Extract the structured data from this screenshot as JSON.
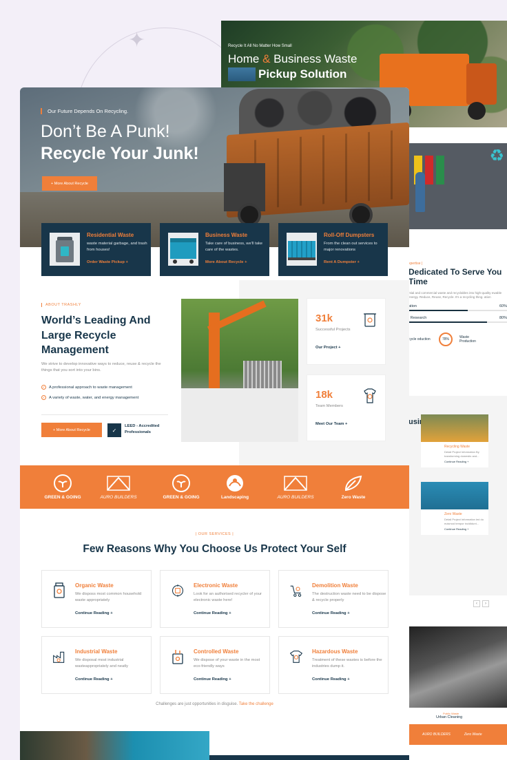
{
  "back_page": {
    "hero_small": "Recycle It All No Matter How Small",
    "hero_title_a": "Home",
    "hero_title_amp": "&",
    "hero_title_b": "Business Waste",
    "hero_title_2": "Pickup Solution",
    "expertise_tag": "xpertise |",
    "expertise_title": "Dedicated To Serve You Time",
    "expertise_text": "ntial and commercial waste and recyclables into high-quality ewable energy. Reduce, Reuse, Recycle. It's a recycling thing. ation",
    "bars": [
      {
        "label": "ation",
        "value": "60%",
        "fill": 0.6
      },
      {
        "label": "l Research",
        "value": "80%",
        "fill": 0.8
      }
    ],
    "circles": [
      {
        "label": "cycle oduction",
        "value": ""
      },
      {
        "label": "Waste Production",
        "value": "78%"
      }
    ],
    "business_heading": "usiness",
    "cards": [
      {
        "title": "Recycling Waste",
        "desc": "Detail Project Information By transforming domestic and...",
        "link": "Continue Reading +"
      },
      {
        "title": "Zero Waste",
        "desc": "Detail Project Information led do euismod tempor incididunt...",
        "link": "Continue Reading +"
      }
    ],
    "arrows": [
      "‹",
      "›"
    ],
    "urban_sub": "Public Waste",
    "urban_title": "Urban Cleaning",
    "brands": [
      "AURO BUILDERS",
      "Zero Waste"
    ]
  },
  "hero": {
    "tag": "Our Future Depends On Recycling.",
    "title_line1": "Don’t Be A Punk!",
    "title_line2": "Recycle Your Junk!",
    "button": "+ More About Recycle"
  },
  "services": [
    {
      "title": "Residential Waste",
      "desc": "waste material garbage, and trash from houses!",
      "link": "Order Waste Pickup +"
    },
    {
      "title": "Business Waste",
      "desc": "Take care of business, we'll take care of the wastes.",
      "link": "More About Recycle +"
    },
    {
      "title": "Roll-Off Dumpsters",
      "desc": "From the clean out services to major renovations",
      "link": "Rent A Dumpster +"
    }
  ],
  "about": {
    "tag": "ABOUT TRASHLY",
    "title": "World’s Leading And Large Recycle Management",
    "text": "We strive to develop innovative ways to reduce, reuse & recycle the things that you sort into your bins.",
    "checks": [
      "A professional approach to waste management",
      "A variety of waste, water, and energy management"
    ],
    "button": "+ More About Recycle",
    "leed": "LEED - Accredited Professionals"
  },
  "stats": [
    {
      "number": "31k",
      "label": "Successful Projects",
      "link": "Our Project +"
    },
    {
      "number": "18k",
      "label": "Team Members",
      "link": "Meet Our Team +"
    }
  ],
  "brands": [
    {
      "name": "GREEN & GOING"
    },
    {
      "name": "AURO BUILDERS"
    },
    {
      "name": "GREEN & GOING"
    },
    {
      "name": "Landscaping"
    },
    {
      "name": "AURO BUILDERS"
    },
    {
      "name": "Zero Waste"
    }
  ],
  "our_services": {
    "tag": "OUR SERVICES",
    "title": "Few Reasons Why You Choose Us Protect Your Self",
    "cards": [
      {
        "title": "Organic Waste",
        "desc": "We disposs most common household waste appropriately",
        "link": "Continue Reading +"
      },
      {
        "title": "Electronic Waste",
        "desc": "Look for an authorised recycler of your electronic waste here!",
        "link": "Continue Reading +"
      },
      {
        "title": "Demolition Waste",
        "desc": "The destruction waste need to be dispose & recycle properly",
        "link": "Continue Reading +"
      },
      {
        "title": "Industrial Waste",
        "desc": "We disposal most industrial wasteappropriately and neatly",
        "link": "Continue Reading +"
      },
      {
        "title": "Controlled Waste",
        "desc": "We dispose of your waste in the most eco-friendly ways",
        "link": "Continue Reading +"
      },
      {
        "title": "Hazardous Waste",
        "desc": "Treatment of these wastes is before the industries dump it.",
        "link": "Continue Reading +"
      }
    ],
    "challenge_text": "Challenges are just opportunities in disguise.",
    "challenge_link": "Take the challenge"
  }
}
